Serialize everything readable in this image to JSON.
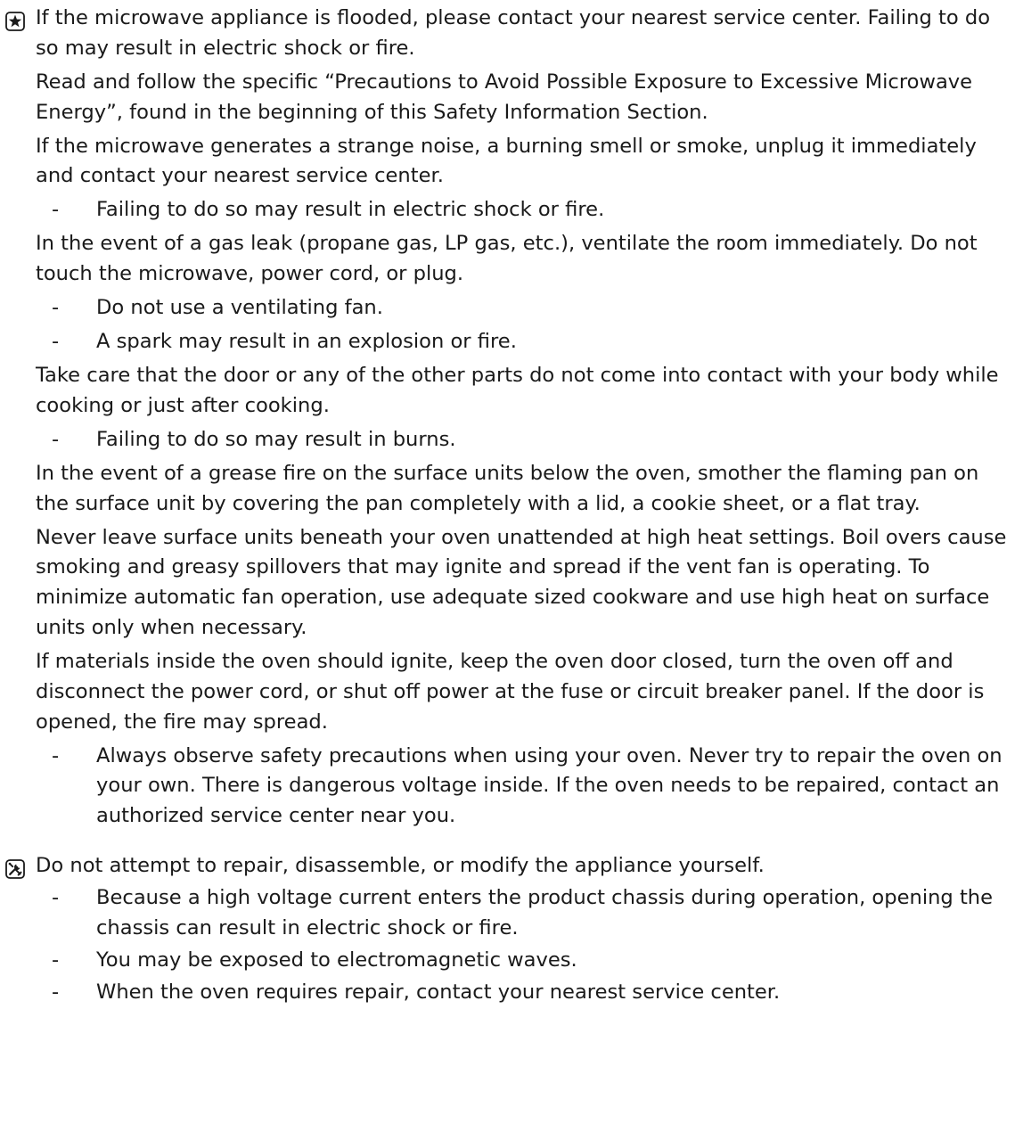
{
  "section_1": {
    "icon": "star-icon",
    "items": [
      {
        "type": "text",
        "text": "If the microwave appliance is flooded, please contact your nearest service center. Failing to do so may result in electric shock or fire."
      },
      {
        "type": "text",
        "text": "Read and follow the specific “Precautions to Avoid Possible Exposure to Excessive Microwave Energy”, found in the beginning of this Safety Information Section."
      },
      {
        "type": "text",
        "text": "If the microwave generates a strange noise, a burning smell or smoke, unplug it immediately and contact your nearest service center."
      },
      {
        "type": "bullet",
        "text": "Failing to do so may result in electric shock or fire."
      },
      {
        "type": "text",
        "text": "In the event of a gas leak (propane gas, LP gas, etc.), ventilate the room immediately. Do not touch the microwave, power cord, or plug."
      },
      {
        "type": "bullet",
        "text": "Do not use a ventilating fan."
      },
      {
        "type": "bullet",
        "text": "A spark may result in an explosion or fire."
      },
      {
        "type": "text",
        "text": "Take care that the door or any of the other parts do not come into contact with your body while cooking or just after cooking."
      },
      {
        "type": "bullet",
        "text": "Failing to do so may result in burns."
      },
      {
        "type": "text",
        "text": "In the event of a grease fire on the surface units below the oven, smother the flaming pan on the surface unit by covering the pan completely with a lid, a cookie sheet, or a flat tray."
      },
      {
        "type": "text",
        "text": "Never leave surface units beneath your oven unattended at high heat settings. Boil overs cause smoking and greasy spillovers that may ignite and spread if the vent fan is operating. To minimize automatic fan operation, use adequate sized cookware and use high heat on surface units only when necessary."
      },
      {
        "type": "text",
        "text": "If materials inside the oven should ignite, keep the oven door closed, turn the oven off and disconnect the power cord, or shut off power at the fuse or circuit breaker panel. If the door is opened, the fire may spread."
      },
      {
        "type": "bullet",
        "text": "Always observe safety precautions when using your oven. Never try to repair the oven on your own. There is dangerous voltage inside. If the oven needs to be repaired, contact an authorized service center near you."
      }
    ]
  },
  "section_2": {
    "icon": "tools-prohibited-icon",
    "items": [
      {
        "type": "text",
        "text": "Do not attempt to repair, disassemble, or modify the appliance yourself."
      },
      {
        "type": "bullet",
        "text": "Because a high voltage current enters the product chassis during operation, opening the chassis can result in electric shock or fire."
      },
      {
        "type": "bullet",
        "text": "You may be exposed to electromagnetic waves."
      },
      {
        "type": "bullet",
        "text": "When the oven requires repair, contact your nearest service center."
      }
    ]
  },
  "dash_glyph": "-",
  "colors": {
    "text": "#1a1a1a",
    "icon": "#1a1a1a"
  }
}
